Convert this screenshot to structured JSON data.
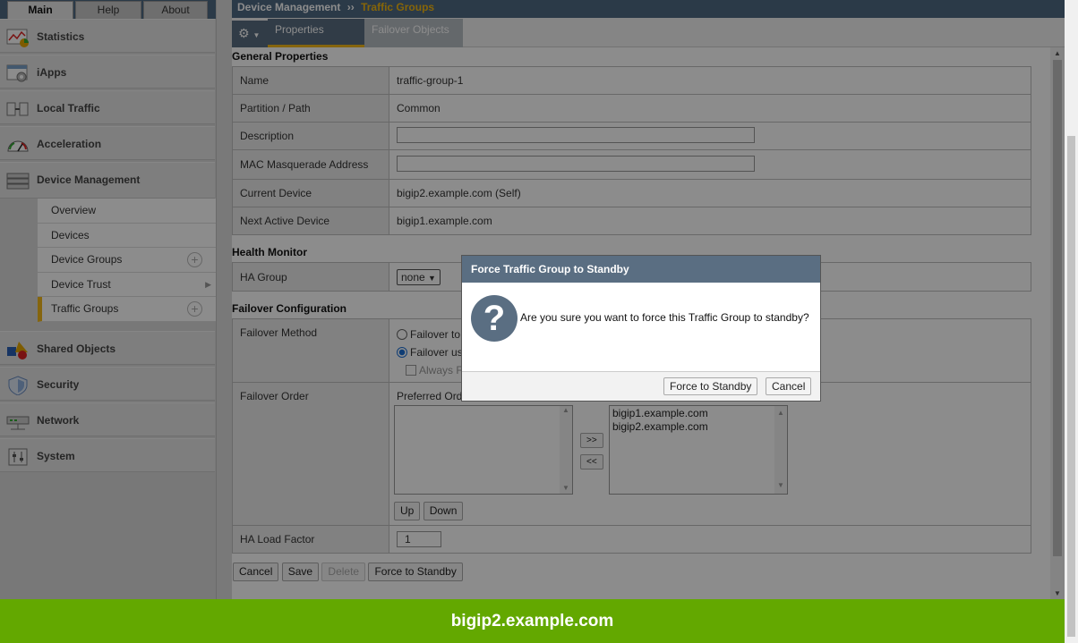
{
  "nav_tabs": [
    "Main",
    "Help",
    "About"
  ],
  "nav_items": {
    "statistics": "Statistics",
    "iapps": "iApps",
    "local_traffic": "Local Traffic",
    "acceleration": "Acceleration",
    "device_management": "Device Management",
    "shared_objects": "Shared Objects",
    "security": "Security",
    "network": "Network",
    "system": "System"
  },
  "subnav": [
    "Overview",
    "Devices",
    "Device Groups",
    "Device Trust",
    "Traffic Groups"
  ],
  "breadcrumb": {
    "parent": "Device Management",
    "separator": "››",
    "current": "Traffic Groups"
  },
  "tabs": {
    "properties": "Properties",
    "failover_objects": "Failover Objects"
  },
  "general": {
    "heading": "General Properties",
    "name_label": "Name",
    "name_value": "traffic-group-1",
    "partition_label": "Partition / Path",
    "partition_value": "Common",
    "description_label": "Description",
    "mac_label": "MAC Masquerade Address",
    "current_label": "Current Device",
    "current_value": "bigip2.example.com (Self)",
    "next_label": "Next Active Device",
    "next_value": "bigip1.example.com"
  },
  "health": {
    "heading": "Health Monitor",
    "ha_group_label": "HA Group",
    "ha_group_value": "none"
  },
  "failover": {
    "heading": "Failover Configuration",
    "method_label": "Failover Method",
    "method_opt1": "Failover to",
    "method_opt2": "Failover us",
    "always_label": "Always F",
    "order_label": "Failover Order",
    "preferred_label": "Preferred Orde",
    "move_right": ">>",
    "move_left": "<<",
    "order_list": [
      "bigip1.example.com",
      "bigip2.example.com"
    ],
    "up": "Up",
    "down": "Down",
    "load_label": "HA Load Factor",
    "load_value": "1"
  },
  "actions": {
    "cancel": "Cancel",
    "save": "Save",
    "delete": "Delete",
    "force": "Force to Standby"
  },
  "modal": {
    "title": "Force Traffic Group to Standby",
    "icon_glyph": "?",
    "message": "Are you sure you want to force this Traffic Group to standby?",
    "confirm": "Force to Standby",
    "cancel": "Cancel"
  },
  "footer": {
    "hostname": "bigip2.example.com"
  },
  "colors": {
    "header": "#4f6a84",
    "accent": "#f2b81a",
    "footer": "#63a800"
  }
}
